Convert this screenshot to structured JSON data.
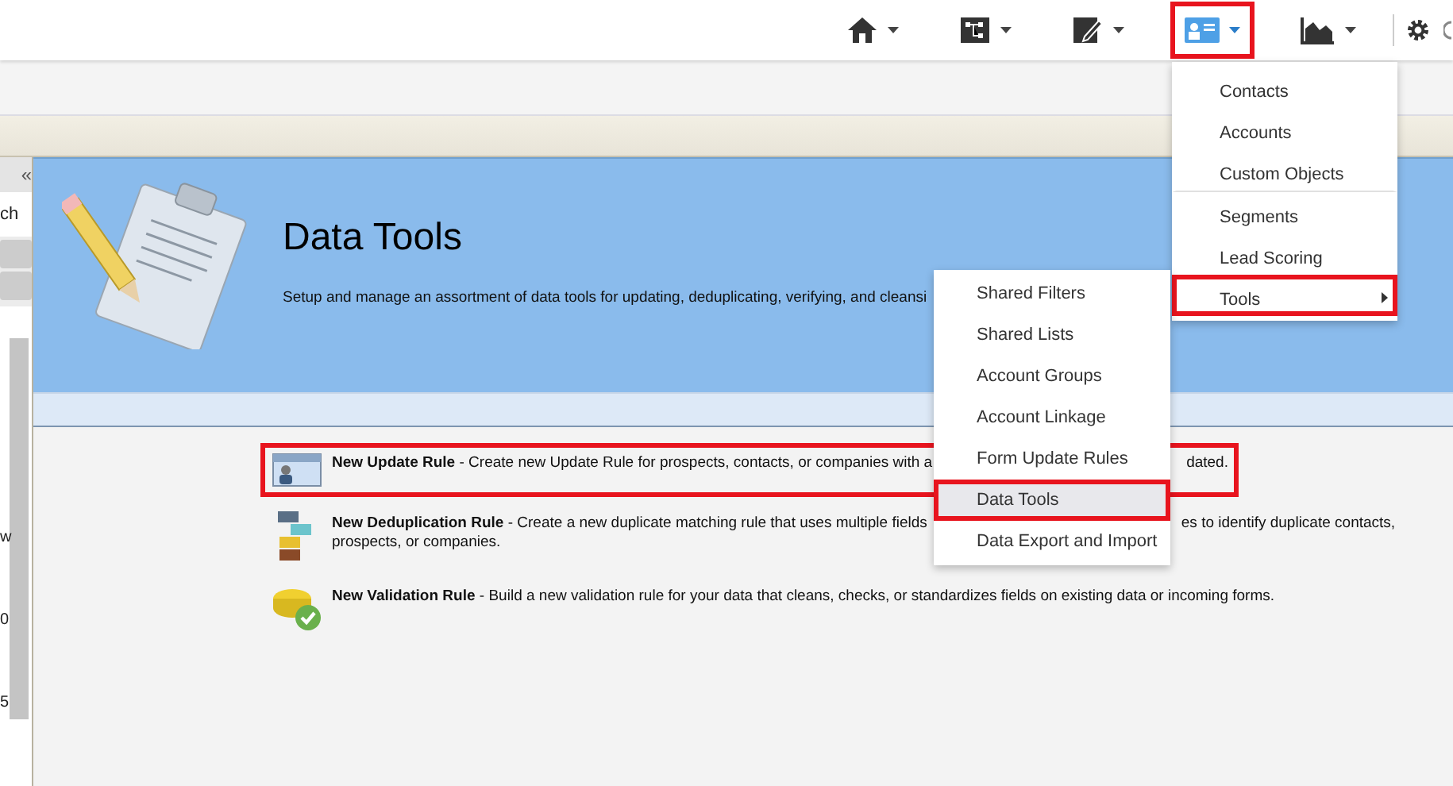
{
  "nav": {
    "items": [
      {
        "kind": "home",
        "selected": false,
        "highlighted": false
      },
      {
        "kind": "diagram",
        "selected": false,
        "highlighted": false
      },
      {
        "kind": "pencil",
        "selected": false,
        "highlighted": false
      },
      {
        "kind": "card",
        "selected": true,
        "highlighted": true
      },
      {
        "kind": "chart",
        "selected": false,
        "highlighted": false
      }
    ]
  },
  "sidebar": {
    "collapse_label": "«",
    "texts": [
      "ch",
      "w",
      "0",
      "5"
    ]
  },
  "header": {
    "title": "Data Tools",
    "subtitle": "Setup and manage an assortment of data tools for updating, deduplicating, verifying, and cleansi"
  },
  "rules": [
    {
      "kind": "update",
      "highlighted": true,
      "lines": [
        "**New Update Rule** - Create new Update Rule for prospects, contacts, or companies with a"
      ],
      "tails": [
        "dated."
      ]
    },
    {
      "kind": "dedupe",
      "highlighted": false,
      "lines": [
        "**New Deduplication Rule** - Create a new duplicate matching rule that uses multiple fields",
        "prospects, or companies."
      ],
      "tails": [
        "es to identify duplicate contacts,"
      ]
    },
    {
      "kind": "validate",
      "highlighted": false,
      "lines": [
        "**New Validation Rule** - Build a new validation rule for your data that cleans, checks, or standardizes fields on existing data or incoming forms."
      ]
    }
  ],
  "menu": {
    "items": [
      {
        "label": "Contacts",
        "divider_after": false,
        "submenu": false,
        "highlighted": false
      },
      {
        "label": "Accounts",
        "divider_after": false,
        "submenu": false,
        "highlighted": false
      },
      {
        "label": "Custom Objects",
        "divider_after": true,
        "submenu": false,
        "highlighted": false
      },
      {
        "label": "Segments",
        "divider_after": false,
        "submenu": false,
        "highlighted": false
      },
      {
        "label": "Lead Scoring",
        "divider_after": false,
        "submenu": false,
        "highlighted": false
      },
      {
        "label": "Tools",
        "divider_after": false,
        "submenu": true,
        "highlighted": true
      }
    ]
  },
  "submenu": {
    "items": [
      {
        "label": "Shared Filters",
        "selected": false
      },
      {
        "label": "Shared Lists",
        "selected": false
      },
      {
        "label": "Account Groups",
        "selected": false
      },
      {
        "label": "Account Linkage",
        "selected": false
      },
      {
        "label": "Form Update Rules",
        "selected": false
      },
      {
        "label": "Data Tools",
        "selected": true
      },
      {
        "label": "Data Export and Import",
        "selected": false
      }
    ]
  }
}
